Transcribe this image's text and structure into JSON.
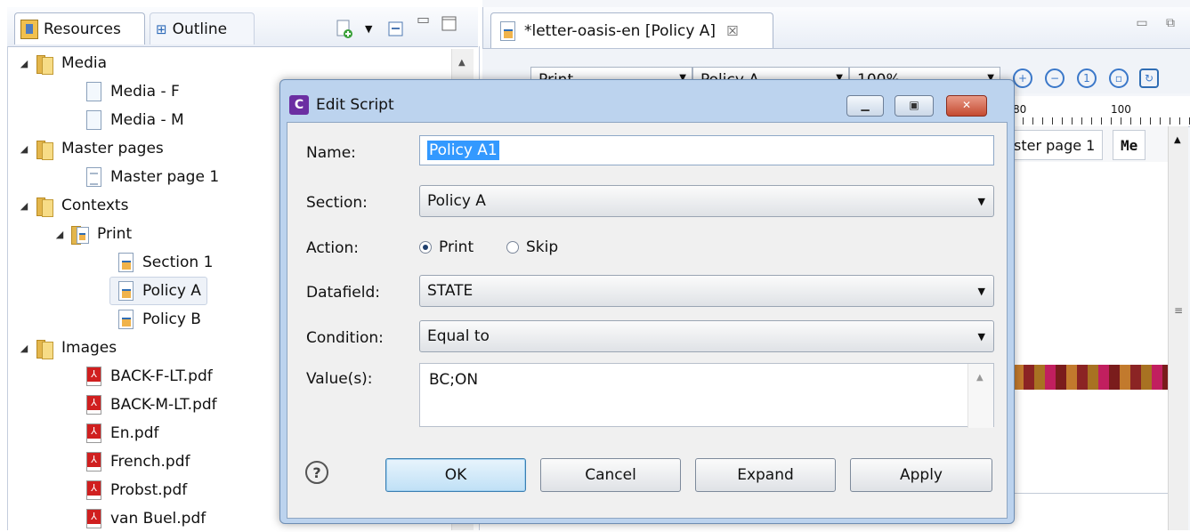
{
  "left_panel": {
    "tabs": [
      {
        "label": "Resources",
        "icon": "resources-icon"
      },
      {
        "label": "Outline",
        "icon": "outline-icon"
      }
    ],
    "toolbar_icons": [
      "new-resource-icon",
      "dropdown-arrow-icon",
      "collapse-all-icon",
      "minimize-icon",
      "maximize-icon"
    ],
    "tree": {
      "media": "Media",
      "media_f": "Media - F",
      "media_m": "Media - M",
      "master_pages": "Master pages",
      "master_page_1": "Master page 1",
      "contexts": "Contexts",
      "print": "Print",
      "section_1": "Section 1",
      "policy_a": "Policy A",
      "policy_b": "Policy B",
      "images": "Images",
      "image_files": [
        "BACK-F-LT.pdf",
        "BACK-M-LT.pdf",
        "En.pdf",
        "French.pdf",
        "Probst.pdf",
        "van Buel.pdf"
      ]
    }
  },
  "editor": {
    "tab_label": "*letter-oasis-en [Policy A]",
    "close_glyph": "☒",
    "toolbar": {
      "context_combo": "Print",
      "section_combo": "Policy A",
      "zoom_combo": "100%"
    },
    "ruler": {
      "mark_80": "80",
      "mark_100": "100"
    },
    "page_tabs": {
      "master": "ster page 1",
      "me": "Me"
    }
  },
  "dialog": {
    "title": "Edit Script",
    "app_icon_letter": "C",
    "fields": {
      "name_label": "Name:",
      "name_value": "Policy A1",
      "section_label": "Section:",
      "section_value": "Policy A",
      "action_label": "Action:",
      "action_print": "Print",
      "action_skip": "Skip",
      "action_selected": "Print",
      "datafield_label": "Datafield:",
      "datafield_value": "STATE",
      "condition_label": "Condition:",
      "condition_value": "Equal to",
      "values_label": "Value(s):",
      "values_value": "BC;ON"
    },
    "buttons": {
      "help": "?",
      "ok": "OK",
      "cancel": "Cancel",
      "expand": "Expand",
      "apply": "Apply"
    }
  },
  "colors": {
    "dialog_frame": "#bcd3ee",
    "selection": "#3399ff",
    "close_button": "#c44a31"
  }
}
